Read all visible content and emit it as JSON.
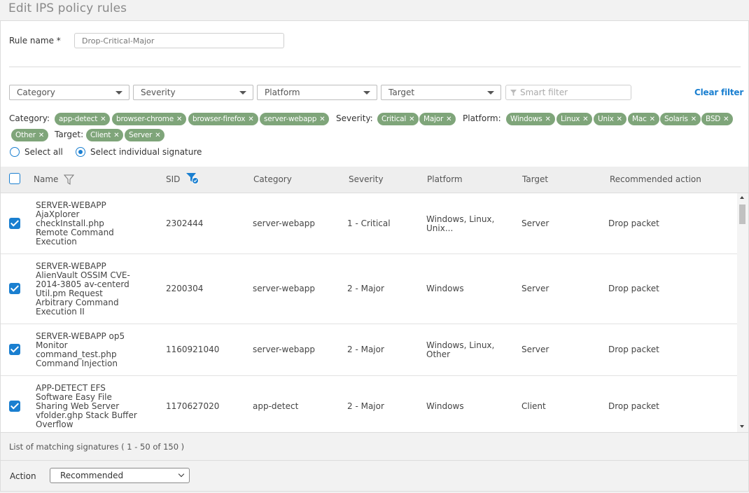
{
  "page": {
    "title": "Edit IPS policy rules"
  },
  "rule": {
    "label": "Rule name *",
    "placeholder": "Drop-Critical-Major"
  },
  "filters": {
    "dropdowns": [
      "Category",
      "Severity",
      "Platform",
      "Target"
    ],
    "smart_placeholder": "Smart filter",
    "clear_label": "Clear filter",
    "category_label": "Category:",
    "category_chips": [
      "app-detect",
      "browser-chrome",
      "browser-firefox",
      "server-webapp"
    ],
    "severity_label": "Severity:",
    "severity_chips": [
      "Critical",
      "Major"
    ],
    "platform_label": "Platform:",
    "platform_chips": [
      "Windows",
      "Linux",
      "Unix",
      "Mac",
      "Solaris",
      "BSD",
      "Other"
    ],
    "target_label": "Target:",
    "target_chips": [
      "Client",
      "Server"
    ]
  },
  "selection": {
    "all_label": "Select all",
    "individual_label": "Select individual signature",
    "selected": "individual"
  },
  "table": {
    "columns": [
      "Name",
      "SID",
      "Category",
      "Severity",
      "Platform",
      "Target",
      "Recommended action"
    ],
    "rows": [
      {
        "checked": true,
        "name": [
          "SERVER-WEBAPP",
          "AjaXplorer",
          "checkInstall.php",
          "Remote Command",
          "Execution"
        ],
        "sid": "2302444",
        "category": "server-webapp",
        "severity": "1 - Critical",
        "platform": [
          "Windows, Linux,",
          "Unix..."
        ],
        "target": "Server",
        "action": "Drop packet"
      },
      {
        "checked": true,
        "name": [
          "SERVER-WEBAPP",
          "AlienVault OSSIM CVE-",
          "2014-3805 av-centerd",
          "Util.pm Request",
          "Arbitrary Command",
          "Execution II"
        ],
        "sid": "2200304",
        "category": "server-webapp",
        "severity": "2 - Major",
        "platform": [
          "Windows"
        ],
        "target": "Server",
        "action": "Drop packet"
      },
      {
        "checked": true,
        "name": [
          "SERVER-WEBAPP op5",
          "Monitor",
          "command_test.php",
          "Command Injection"
        ],
        "sid": "1160921040",
        "category": "server-webapp",
        "severity": "2 - Major",
        "platform": [
          "Windows, Linux,",
          "Other"
        ],
        "target": "Server",
        "action": "Drop packet"
      },
      {
        "checked": true,
        "name": [
          "APP-DETECT EFS",
          "Software Easy File",
          "Sharing Web Server",
          "vfolder.ghp Stack Buffer",
          "Overflow"
        ],
        "sid": "1170627020",
        "category": "app-detect",
        "severity": "2 - Major",
        "platform": [
          "Windows"
        ],
        "target": "Client",
        "action": "Drop packet"
      }
    ]
  },
  "footer": {
    "status": "List of matching signatures ( 1 - 50 of 150 )"
  },
  "action": {
    "label": "Action",
    "value": "Recommended"
  },
  "colors": {
    "accent": "#1a7fd0",
    "chip": "#7fa57a"
  }
}
